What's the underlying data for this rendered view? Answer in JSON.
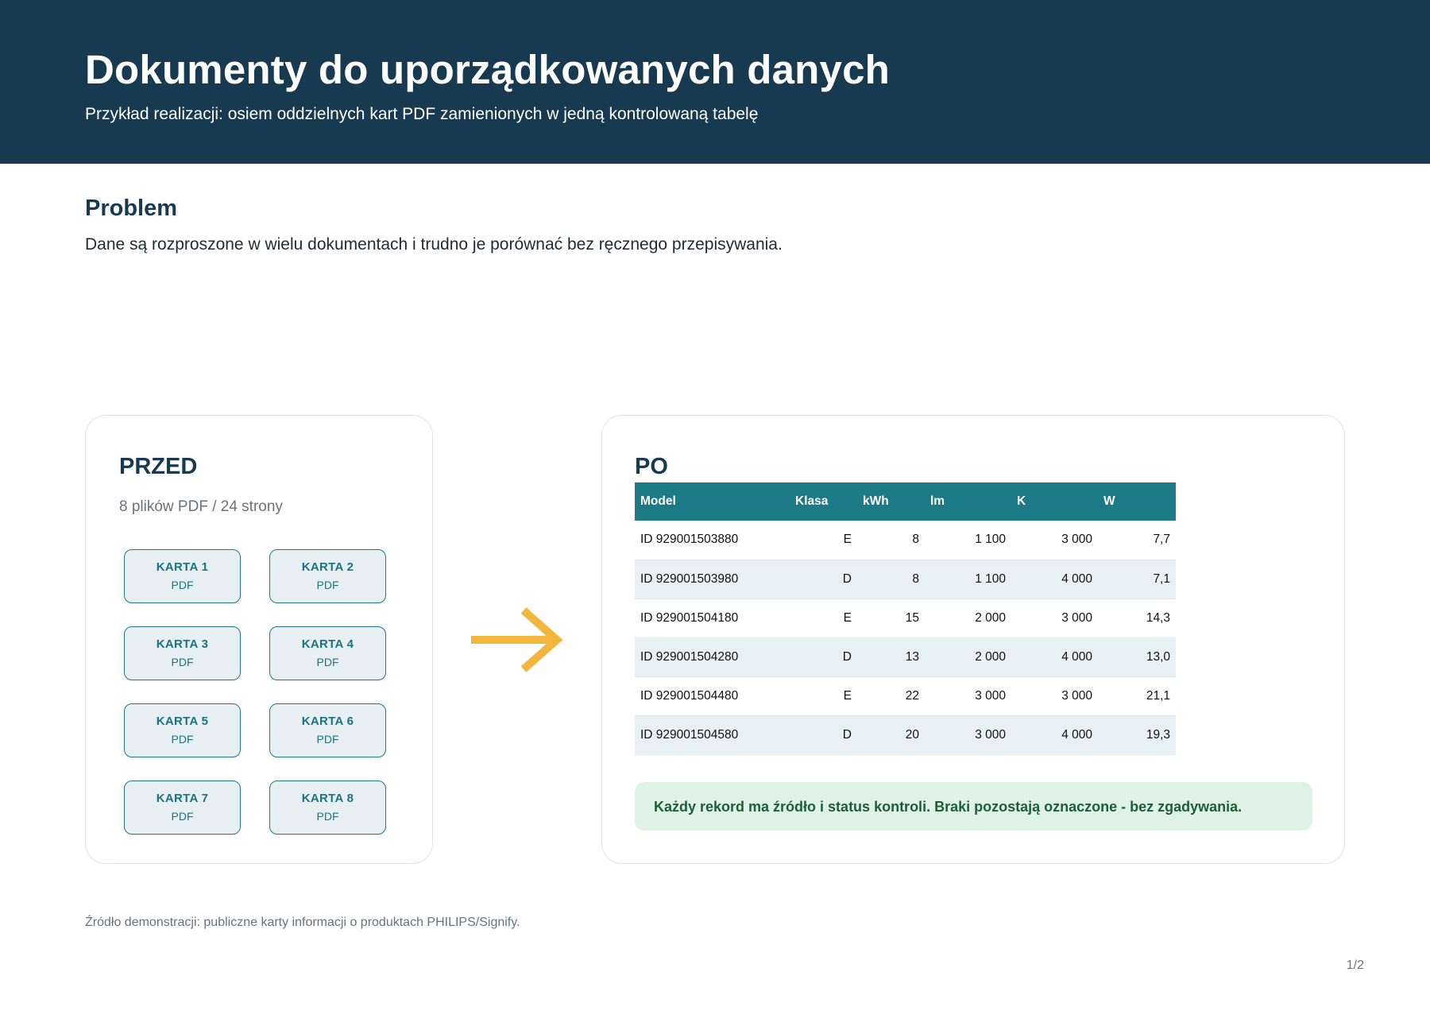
{
  "header": {
    "title": "Dokumenty do uporządkowanych danych",
    "subtitle": "Przykład realizacji: osiem oddzielnych kart PDF zamienionych w jedną kontrolowaną tabelę"
  },
  "problem": {
    "title": "Problem",
    "text": "Dane są rozproszone w wielu dokumentach i trudno je porównać bez ręcznego przepisywania."
  },
  "before": {
    "title": "PRZED",
    "subtitle": "8 plików PDF / 24 strony",
    "cards": [
      {
        "label": "KARTA 1",
        "type": "PDF"
      },
      {
        "label": "KARTA 2",
        "type": "PDF"
      },
      {
        "label": "KARTA 3",
        "type": "PDF"
      },
      {
        "label": "KARTA 4",
        "type": "PDF"
      },
      {
        "label": "KARTA 5",
        "type": "PDF"
      },
      {
        "label": "KARTA 6",
        "type": "PDF"
      },
      {
        "label": "KARTA 7",
        "type": "PDF"
      },
      {
        "label": "KARTA 8",
        "type": "PDF"
      }
    ]
  },
  "after": {
    "title": "PO",
    "table": {
      "columns": [
        "Model",
        "Klasa",
        "kWh",
        "lm",
        "K",
        "W"
      ],
      "rows": [
        [
          "ID 929001503880",
          "E",
          "8",
          "1 100",
          "3 000",
          "7,7"
        ],
        [
          "ID 929001503980",
          "D",
          "8",
          "1 100",
          "4 000",
          "7,1"
        ],
        [
          "ID 929001504180",
          "E",
          "15",
          "2 000",
          "3 000",
          "14,3"
        ],
        [
          "ID 929001504280",
          "D",
          "13",
          "2 000",
          "4 000",
          "13,0"
        ],
        [
          "ID 929001504480",
          "E",
          "22",
          "3 000",
          "3 000",
          "21,1"
        ],
        [
          "ID 929001504580",
          "D",
          "20",
          "3 000",
          "4 000",
          "19,3"
        ]
      ]
    },
    "note": "Każdy rekord ma źródło i status kontroli. Braki pozostają oznaczone - bez zgadywania."
  },
  "arrow_icon": "arrow-right-icon",
  "colors": {
    "header_bg": "#183a50",
    "accent_teal": "#1b7a86",
    "arrow": "#f2b63c",
    "note_bg": "#dff3e5",
    "note_text": "#1c5e39"
  },
  "footer": {
    "source": "Źródło demonstracji: publiczne karty informacji o produktach PHILIPS/Signify.",
    "page": "1/2"
  }
}
